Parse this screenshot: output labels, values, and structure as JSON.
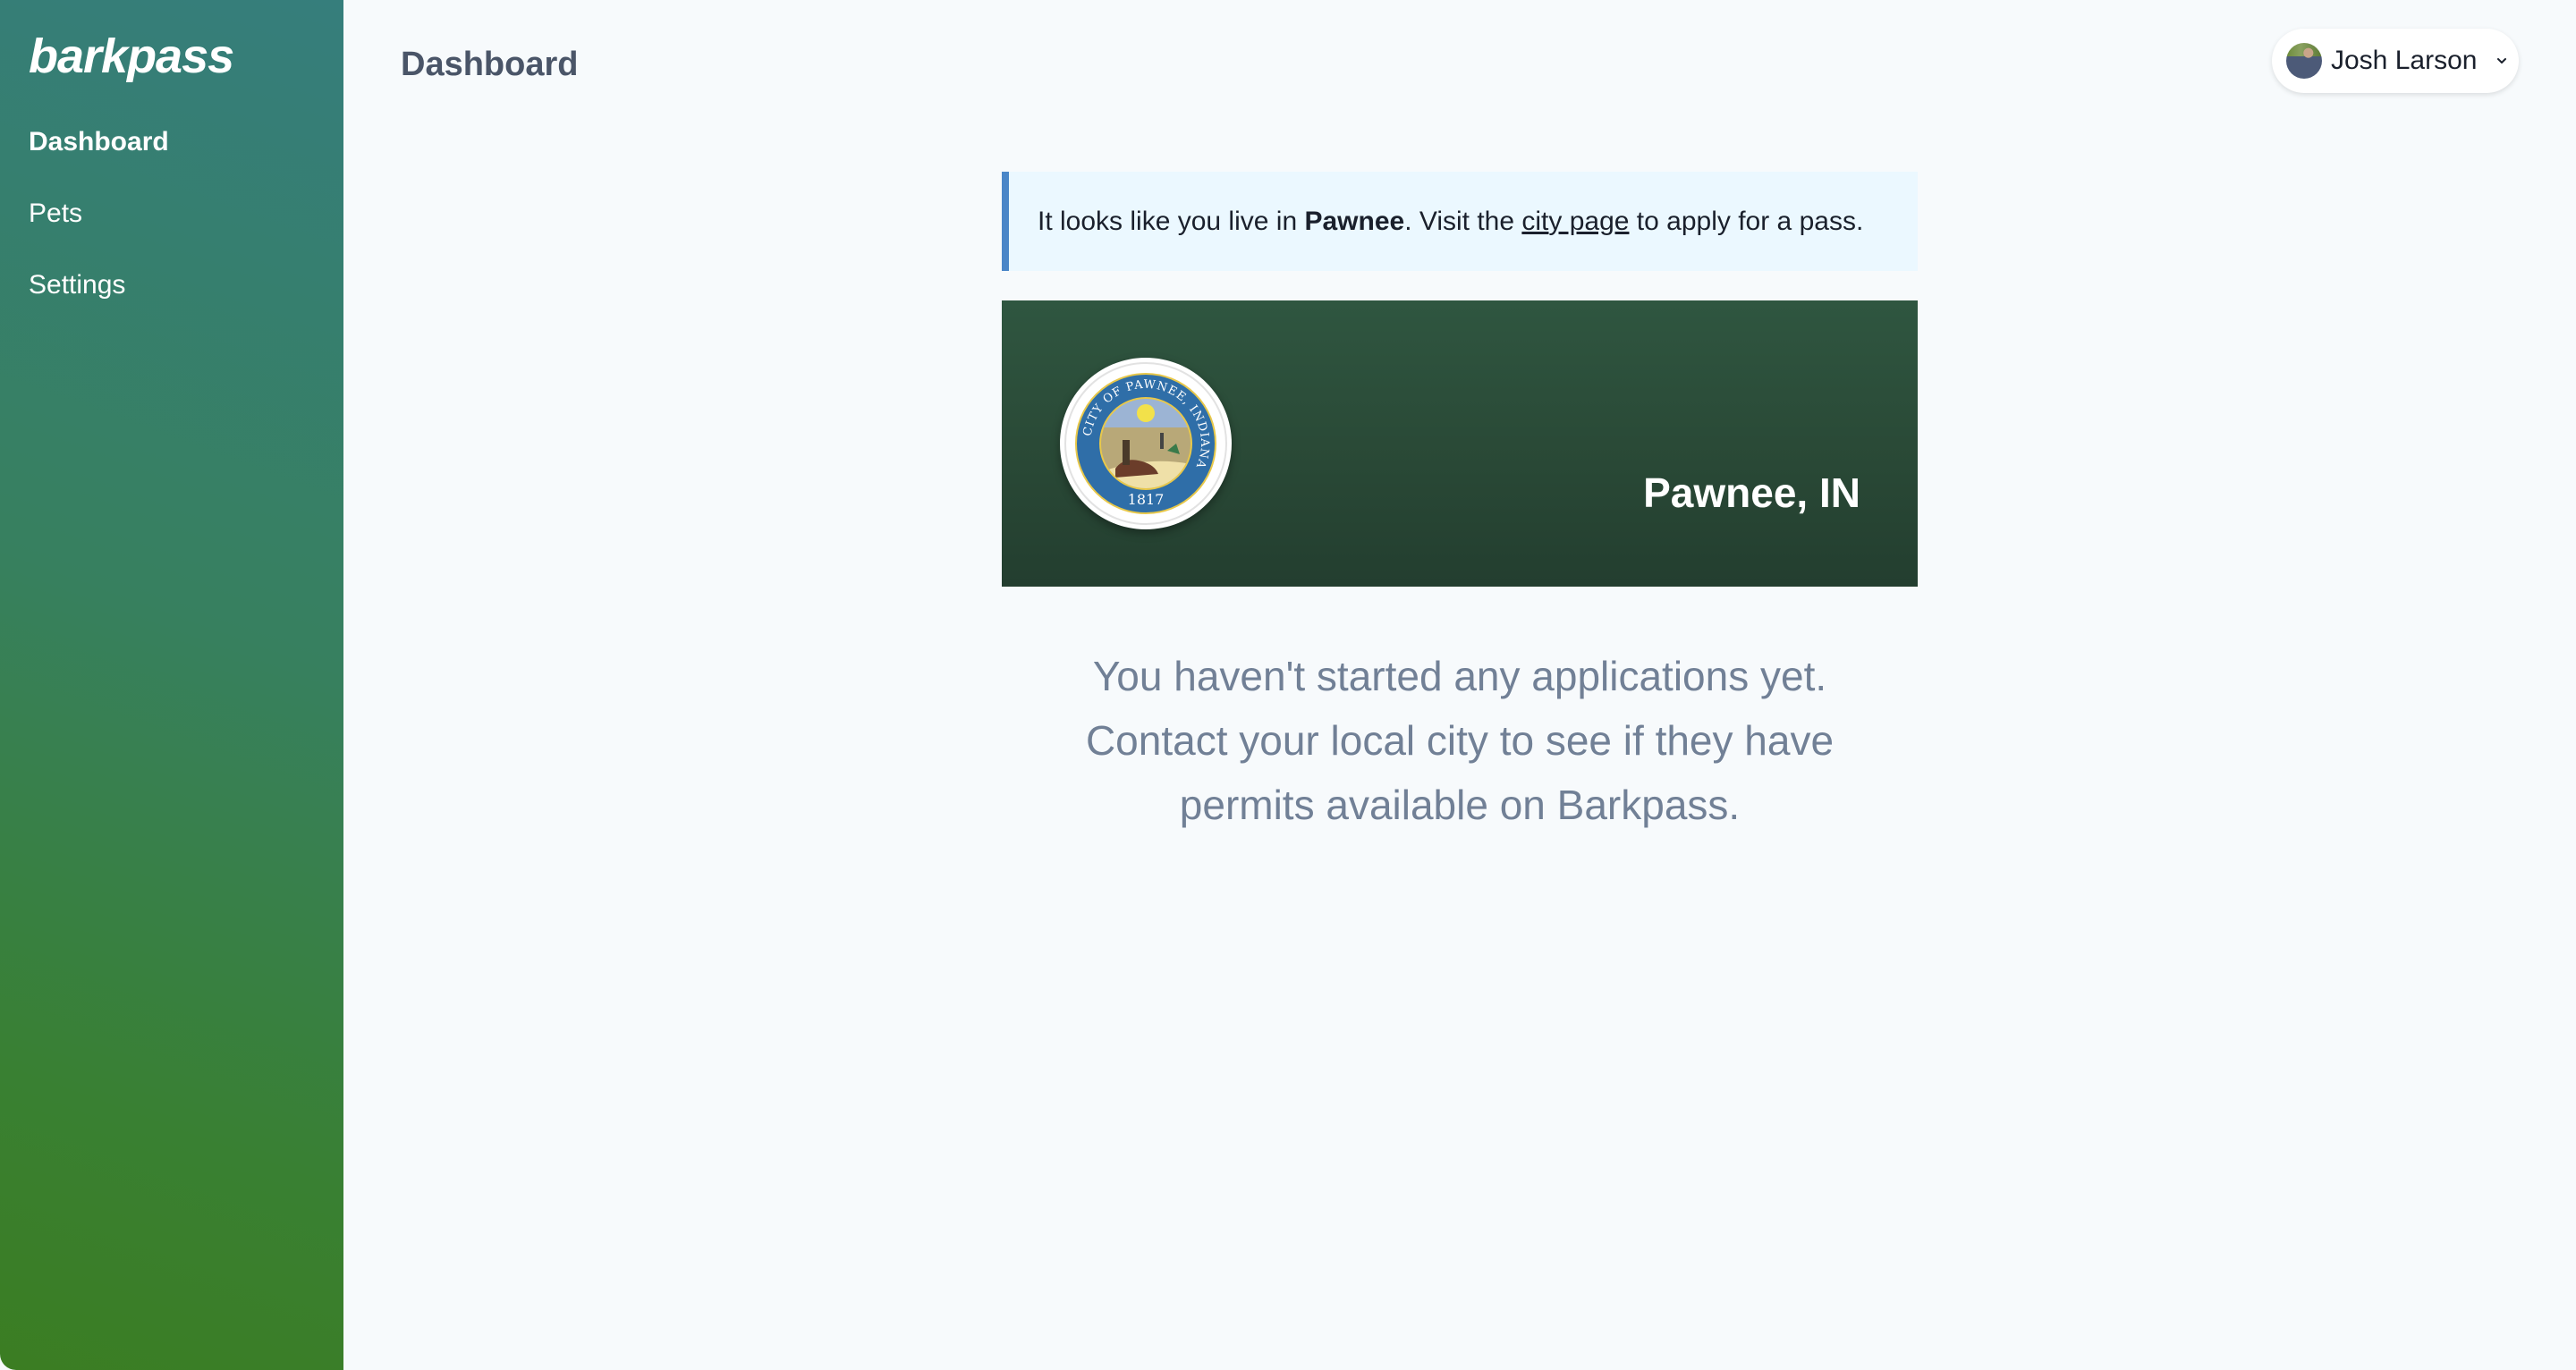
{
  "app": {
    "logo_text": "barkpass"
  },
  "sidebar": {
    "items": [
      {
        "label": "Dashboard",
        "active": true
      },
      {
        "label": "Pets",
        "active": false
      },
      {
        "label": "Settings",
        "active": false
      }
    ]
  },
  "header": {
    "title": "Dashboard",
    "user": {
      "name": "Josh Larson",
      "avatar_icon": "user-photo",
      "menu_icon": "chevron-down-icon"
    }
  },
  "alert": {
    "prefix": "It looks like you live in ",
    "city_bold": "Pawnee",
    "middle": ". Visit the ",
    "link_text": "city page",
    "suffix": " to apply for a pass.",
    "accent_color": "#4a86c8",
    "background_color": "#ebf8ff"
  },
  "city_banner": {
    "city_name": "Pawnee, IN",
    "seal": {
      "ring_text": "CITY OF PAWNEE, INDIANA",
      "year": "1817"
    }
  },
  "empty_state": {
    "lines": [
      "You haven't started any applications yet.",
      "Contact your local city to see if they have",
      "permits available on Barkpass."
    ]
  }
}
